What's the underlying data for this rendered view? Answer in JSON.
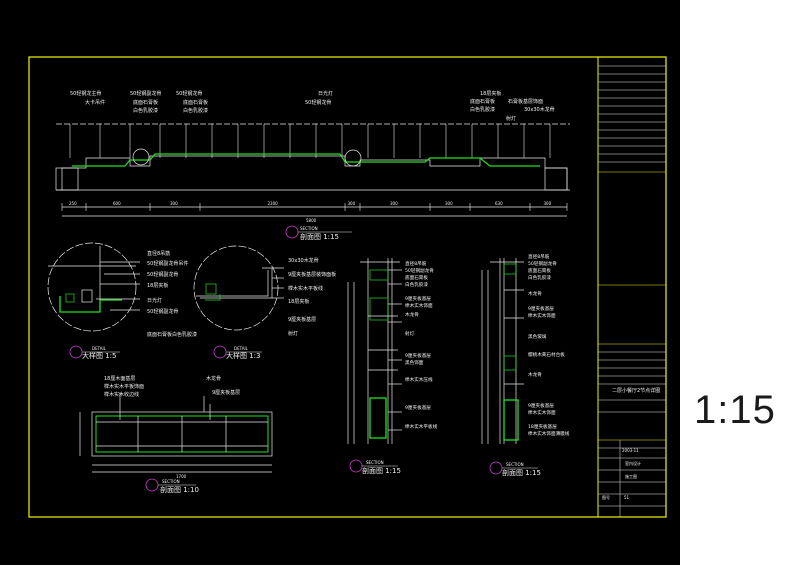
{
  "big_scale_label": "1:15",
  "colors": {
    "frame": "#f2f20a",
    "line": "#e8e8e8",
    "accent": "#22e01e",
    "text": "#f0f0f0",
    "cyan": "#33e6e6",
    "red": "#ff3030",
    "magenta": "#d33cd3"
  },
  "top_section": {
    "label_top_row": [
      "50轻钢龙主骨",
      "大卡吊件",
      "50轻钢副龙骨",
      "底面石膏板",
      "白色乳胶漆",
      "50轻钢龙骨",
      "底面石膏板",
      "白色乳胶漆",
      "日光灯",
      "50轻钢龙骨",
      "18层夹板",
      "底面石膏板",
      "白色乳胶漆",
      "石膏板基层饰面",
      "30x30木龙骨",
      "射灯"
    ],
    "dimensions": [
      "250",
      "600",
      "300",
      "2300",
      "300",
      "300",
      "300",
      "630",
      "300"
    ],
    "total": "5800",
    "title": "剖面图 1:15",
    "tag": "SECTION"
  },
  "detail_a": {
    "title": "大样图 1:5",
    "tag": "DETAIL",
    "labels": [
      "直径8吊筋",
      "50轻钢副龙骨吊件",
      "50轻钢副龙骨",
      "18层夹板",
      "日光灯",
      "50轻钢副龙骨",
      "底面石膏板白色乳胶漆"
    ]
  },
  "detail_b": {
    "title": "大样图 1:3",
    "tag": "DETAIL",
    "labels": [
      "30x30木龙骨",
      "9厘夹板基层装饰面板",
      "榉木实木平板线",
      "18层夹板",
      "9厘夹板基层",
      "射灯"
    ]
  },
  "section_c": {
    "title": "剖面图 1:10",
    "tag": "SECTION",
    "labels": [
      "18厘木面基层",
      "榉木实木平板饰面",
      "木龙骨",
      "9厘夹板基层",
      "榉木实木收边线"
    ],
    "dim": "1700"
  },
  "section_d": {
    "title": "剖面图 1:15",
    "tag": "SECTION",
    "labels": [
      "直径8吊筋",
      "50轻钢副龙骨",
      "底面石膏板",
      "白色乳胶漆",
      "9厘夹板基层",
      "榉木实木饰面",
      "木龙骨",
      "射灯",
      "9厘夹板基层",
      "黑色饰面",
      "榉木实木压线",
      "9厘夹板基层",
      "榉木实木平板线"
    ]
  },
  "section_e": {
    "title": "剖面图 1:15",
    "tag": "SECTION",
    "labels": [
      "直径8吊筋",
      "50轻钢副龙骨",
      "底面石膏板",
      "白色乳胶漆",
      "木龙骨",
      "9厘夹板基层",
      "榉木实木饰面",
      "黑色玻璃",
      "樱桃木黄石材台板",
      "木龙骨",
      "9厘夹板基层",
      "榉木实木饰面",
      "18厘夹板基层",
      "榉木实木饰面薄膜线"
    ]
  },
  "title_block": {
    "project": "二层小餐厅2节点详图",
    "date": "2003-11",
    "designer": "室内设计",
    "drawn": "施工图",
    "sheet_no": "51",
    "scale_label": "图号"
  }
}
